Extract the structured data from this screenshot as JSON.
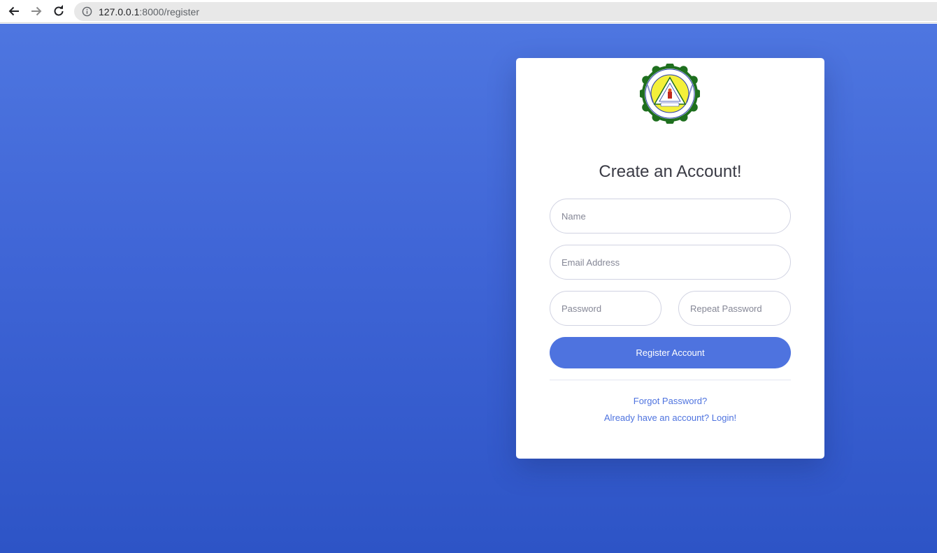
{
  "browser": {
    "url_host": "127.0.0.1",
    "url_path": ":8000/register",
    "icons": [
      "back-arrow-icon",
      "forward-arrow-icon",
      "reload-icon",
      "info-icon"
    ]
  },
  "form": {
    "title": "Create an Account!",
    "name_placeholder": "Name",
    "email_placeholder": "Email Address",
    "password_placeholder": "Password",
    "repeat_password_placeholder": "Repeat Password",
    "register_label": "Register Account",
    "forgot_link": "Forgot Password?",
    "login_link": "Already have an account? Login!"
  },
  "colors": {
    "primary": "#4e73df",
    "background_top": "#4e76e0",
    "background_bottom": "#2d54c6",
    "seal_ring": "#1e7a1e",
    "seal_center": "#f4f03a"
  }
}
